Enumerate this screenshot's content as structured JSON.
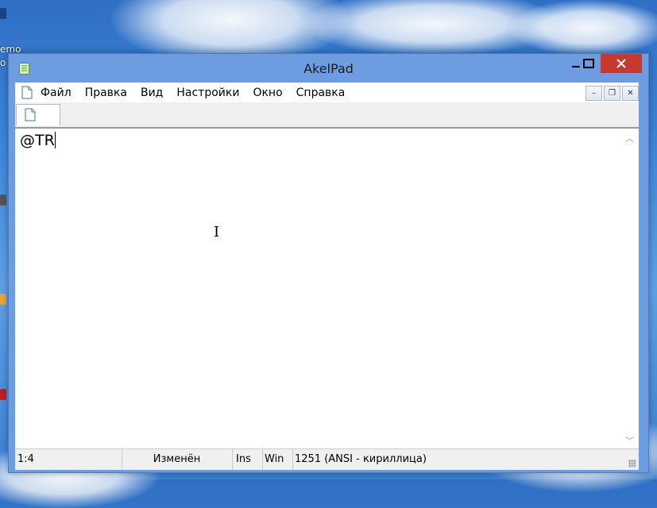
{
  "desktop": {
    "fragments": [
      "emo",
      "o"
    ]
  },
  "window": {
    "title": "AkelPad",
    "controls": {
      "minimize": "—",
      "maximize": "☐",
      "close": "✕"
    }
  },
  "menu": {
    "items": [
      "Файл",
      "Правка",
      "Вид",
      "Настройки",
      "Окно",
      "Справка"
    ],
    "mdi": {
      "minimize": "–",
      "restore": "❐",
      "close": "✕"
    }
  },
  "editor": {
    "text": "@TR"
  },
  "status": {
    "position": "1:4",
    "modified": "Изменён",
    "insert_mode": "Ins",
    "newline": "Win",
    "encoding": "1251  (ANSI - кириллица)"
  },
  "colors": {
    "titlebar": "#6d9de0",
    "close_button": "#c7392c",
    "editor_bg": "#ffffff"
  }
}
